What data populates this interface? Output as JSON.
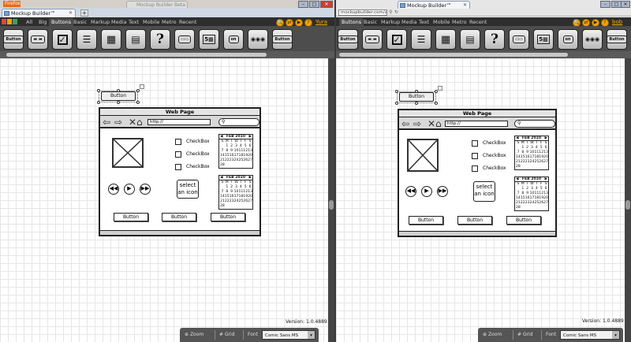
{
  "left": {
    "ff_button": "Firefox",
    "tab_title": "Mockup Builder™",
    "ghost_tab": "Mockup Builder Beta",
    "categories": [
      "All",
      "Big",
      "Buttons",
      "Basic",
      "Markup",
      "Media",
      "Text",
      "Mobile",
      "Metro",
      "Recent"
    ],
    "selected_category": "Buttons",
    "user_name": "Yura"
  },
  "right": {
    "url": "mockupbuilder.com/a",
    "tab_title": "Mockup Builder™",
    "categories": [
      "Buttons",
      "Basic",
      "Markup",
      "Media",
      "Text",
      "Mobile",
      "Metro",
      "Recent"
    ],
    "selected_category": "Buttons",
    "user_name": "bob"
  },
  "mockup": {
    "standalone_button": "Button",
    "webpage_title": "Web Page",
    "url_text": "http://",
    "checkboxes": [
      "CheckBox",
      "CheckBox",
      "CheckBox"
    ],
    "calendar": {
      "month": "FEB 2010",
      "days_header": [
        "S",
        "M",
        "T",
        "W",
        "T",
        "F",
        "S"
      ],
      "days": [
        "",
        "1",
        "2",
        "3",
        "4",
        "5",
        "6",
        "7",
        "8",
        "9",
        "10",
        "11",
        "12",
        "13",
        "14",
        "15",
        "16",
        "17",
        "18",
        "19",
        "20",
        "21",
        "22",
        "23",
        "24",
        "25",
        "26",
        "27",
        "28"
      ]
    },
    "select_icon": "select an icon",
    "buttons": [
      "Button",
      "Button",
      "Button"
    ],
    "media_icons": [
      "rewind-icon",
      "play-icon",
      "forward-icon"
    ]
  },
  "toolbar_icons": [
    "button",
    "split-button",
    "checkbox",
    "list",
    "grid",
    "form",
    "help",
    "tabs",
    "calendar",
    "toggle",
    "media",
    "button-small"
  ],
  "status": {
    "version": "Version: 1.0.4889",
    "zoom": "Zoom",
    "grid": "Grid",
    "font_label": "Font",
    "font_value": "Comic Sans MS"
  },
  "colors": {
    "toolbar_bg": "#3c3c3c",
    "accent_orange": "#f2a300"
  }
}
